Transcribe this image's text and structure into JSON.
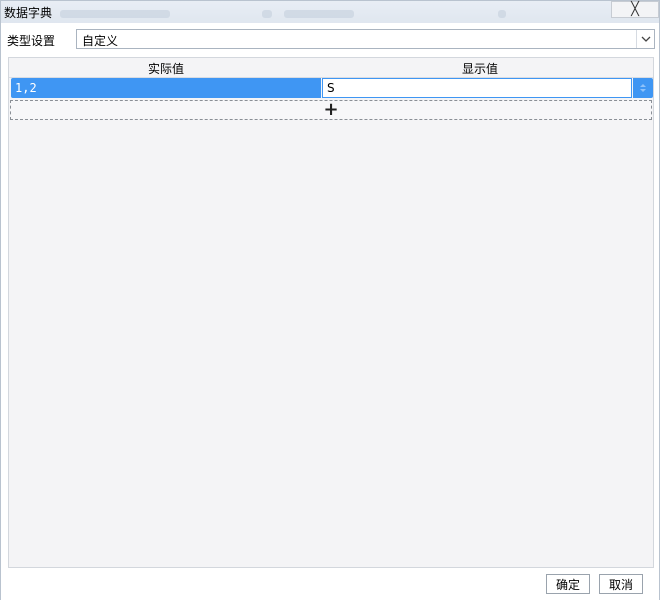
{
  "window": {
    "title": "数据字典",
    "close_glyph": "╳"
  },
  "type_setting": {
    "label": "类型设置",
    "selected": "自定义"
  },
  "grid": {
    "columns": [
      "实际值",
      "显示值"
    ],
    "rows": [
      {
        "actual": "1,2",
        "display": "S"
      }
    ],
    "add_glyph": "+"
  },
  "buttons": {
    "ok": "确定",
    "cancel": "取消"
  },
  "colors": {
    "accent": "#3f96f3",
    "panel_bg": "#f4f4f6"
  },
  "icons": {
    "close": "close-icon",
    "dropdown": "chevron-down-icon",
    "spinner": "spin-icon",
    "add": "plus-icon"
  }
}
